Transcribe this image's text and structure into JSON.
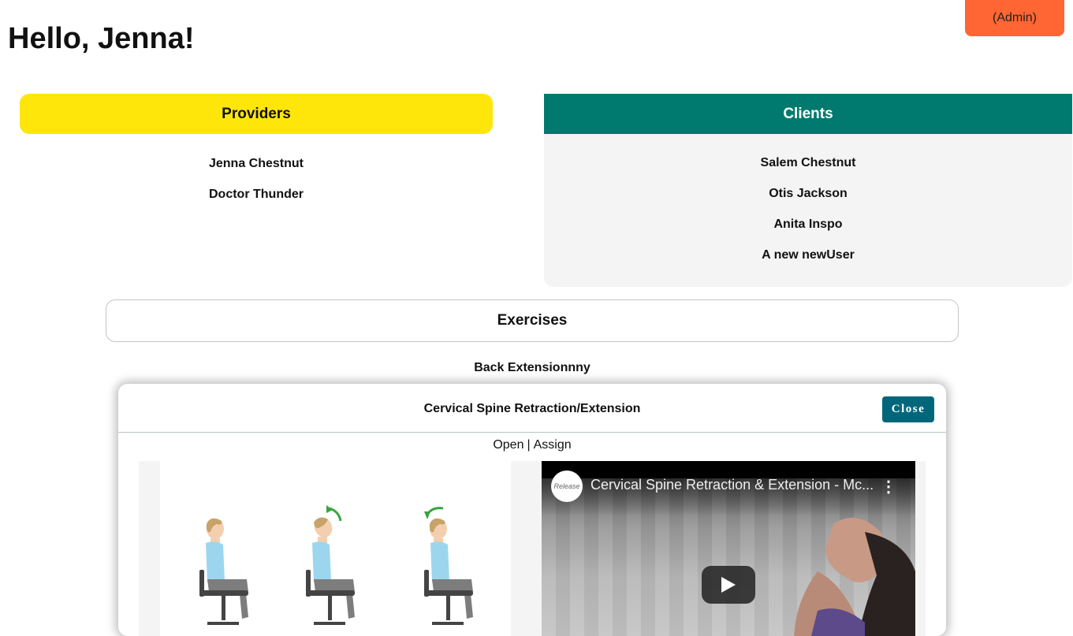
{
  "greeting": "Hello, Jenna!",
  "admin_button": "(Admin)",
  "providers": {
    "title": "Providers",
    "items": [
      "Jenna Chestnut",
      "Doctor Thunder"
    ]
  },
  "clients": {
    "title": "Clients",
    "items": [
      "Salem Chestnut",
      "Otis Jackson",
      "Anita Inspo",
      "A new newUser"
    ]
  },
  "exercises": {
    "title": "Exercises",
    "items": [
      "Back Extensionnny"
    ]
  },
  "modal": {
    "title": "Cervical Spine Retraction/Extension",
    "close_label": "Close",
    "open_link": "Open",
    "separator": "|",
    "assign_link": "Assign",
    "video": {
      "title": "Cervical Spine Retraction & Extension - Mc...",
      "logo_text": "Release"
    }
  },
  "colors": {
    "providers_accent": "#ffe60a",
    "clients_accent": "#007a6e",
    "admin_accent": "#ff6633",
    "close_button": "#00677a"
  },
  "icons": [
    "menu-dots-icon",
    "play-icon"
  ]
}
